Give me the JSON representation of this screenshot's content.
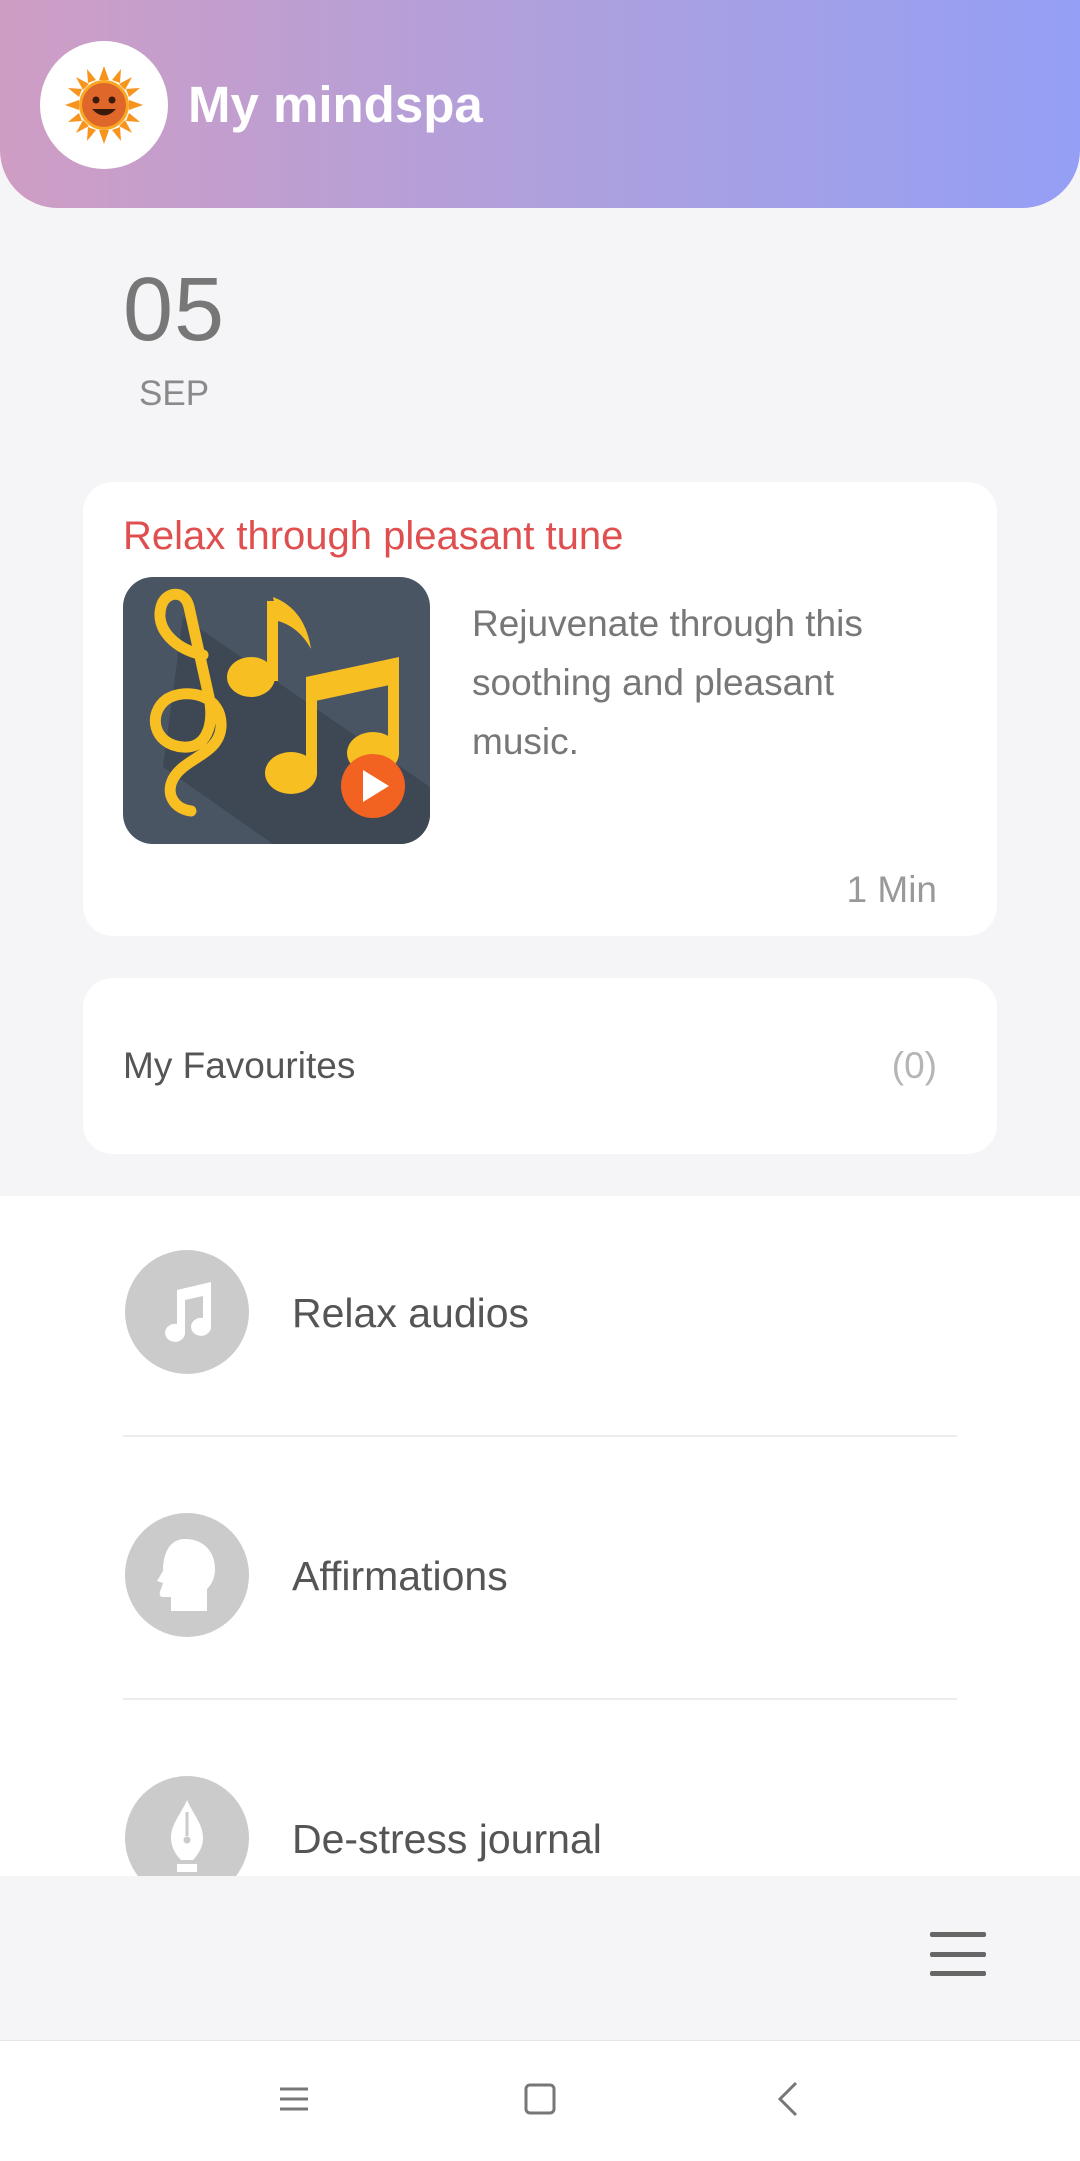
{
  "header": {
    "title": "My mindspa",
    "logo_icon": "sun-face-icon"
  },
  "date": {
    "day": "05",
    "month": "SEP"
  },
  "feature": {
    "title": "Relax through pleasant tune",
    "description": "Rejuvenate through this soothing and pleasant music.",
    "duration": "1 Min",
    "thumbnail_icon": "music-notes-icon",
    "play_icon": "play-icon"
  },
  "favourites": {
    "label": "My Favourites",
    "count": "(0)"
  },
  "list": {
    "items": [
      {
        "label": "Relax audios",
        "icon": "music-note-icon"
      },
      {
        "label": "Affirmations",
        "icon": "head-profile-icon"
      },
      {
        "label": "De-stress journal",
        "icon": "pen-nib-icon"
      }
    ]
  },
  "colors": {
    "header_gradient_start": "#cf9dc4",
    "header_gradient_end": "#949ff5",
    "feature_title": "#df4f4f",
    "play_button": "#f26322",
    "notes": "#f8bf22",
    "thumb_bg": "#4a5564"
  },
  "system_nav": {
    "icons": [
      "recents-icon",
      "home-icon",
      "back-icon"
    ]
  }
}
